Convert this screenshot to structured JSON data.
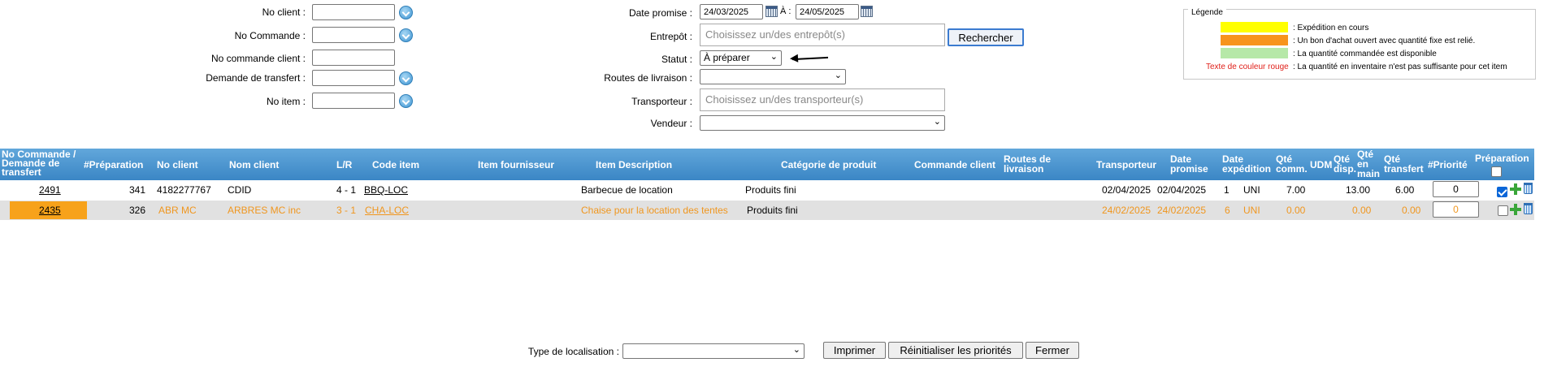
{
  "filters": {
    "no_client_label": "No client :",
    "no_commande_label": "No Commande :",
    "no_commande_client_label": "No commande client :",
    "demande_transfert_label": "Demande de transfert :",
    "no_item_label": "No item :",
    "date_promise_label": "Date promise :",
    "date_from": "24/03/2025",
    "a_label": "À :",
    "date_to": "24/05/2025",
    "entrepot_label": "Entrepôt :",
    "entrepot_placeholder": "Choisissez un/des entrepôt(s)",
    "rechercher_label": "Rechercher",
    "statut_label": "Statut :",
    "statut_value": "À préparer",
    "routes_label": "Routes de livraison :",
    "routes_value": "",
    "transporteur_label": "Transporteur :",
    "transporteur_placeholder": "Choisissez un/des transporteur(s)",
    "vendeur_label": "Vendeur :",
    "vendeur_value": ""
  },
  "legend": {
    "title": "Légende",
    "items": [
      {
        "color": "#ffff00",
        "text": ": Expédition en cours"
      },
      {
        "color": "#f7941d",
        "text": ": Un bon d'achat ouvert avec quantité fixe est relié."
      },
      {
        "color": "#b6e8a8",
        "text": ": La quantité commandée est disponible"
      }
    ],
    "red_label": "Texte de couleur rouge",
    "red_text": ": La quantité en inventaire n'est pas suffisante pour cet item"
  },
  "table": {
    "headers": {
      "no_commande": "No Commande /",
      "demande_de": "Demande de",
      "transfert": "transfert",
      "preparation_no": "#Préparation",
      "no_client": "No client",
      "nom_client": "Nom client",
      "lr": "L/R",
      "code_item": "Code item",
      "item_fournisseur": "Item fournisseur",
      "item_description": "Item Description",
      "categorie": "Catégorie de produit",
      "commande_client": "Commande client",
      "routes_1": "Routes de",
      "routes_2": "livraison",
      "transporteur": "Transporteur",
      "date_promise_1": "Date",
      "date_promise_2": "promise",
      "date_exp_1": "Date",
      "date_exp_2": "expédition",
      "qte_comm_1": "Qté",
      "qte_comm_2": "comm.",
      "udm": "UDM",
      "qte_disp_1": "Qté",
      "qte_disp_2": "disp.",
      "qte_main_1": "Qté",
      "qte_main_2": "en",
      "qte_main_3": "main",
      "qte_transfert_1": "Qté",
      "qte_transfert_2": "transfert",
      "priorite": "#Priorité",
      "preparation": "Préparation"
    },
    "rows": [
      {
        "commande": "2491",
        "preparation": "341",
        "no_client": "4182277767",
        "nom_client": "CDID",
        "lr": "4 - 1",
        "code_item": "BBQ-LOC",
        "item_fournisseur": "",
        "description": "Barbecue de location",
        "categorie": "Produits fini",
        "commande_client": "",
        "routes": "",
        "transporteur": "",
        "date_promise": "02/04/2025",
        "date_expedition": "02/04/2025",
        "qte_comm": "1",
        "udm": "UNI",
        "qte_disp": "7.00",
        "qte_main": "13.00",
        "qte_transfert": "6.00",
        "priorite": "0",
        "checked": true
      },
      {
        "commande": "2435",
        "preparation": "326",
        "no_client": "ABR MC",
        "nom_client": "ARBRES MC inc",
        "lr": "3 - 1",
        "code_item": "CHA-LOC",
        "item_fournisseur": "",
        "description": "Chaise pour la location des tentes",
        "categorie": "Produits fini",
        "commande_client": "",
        "routes": "",
        "transporteur": "",
        "date_promise": "24/02/2025",
        "date_expedition": "24/02/2025",
        "qte_comm": "6",
        "udm": "UNI",
        "qte_disp": "0.00",
        "qte_main": "0.00",
        "qte_transfert": "0.00",
        "priorite": "0",
        "checked": false
      }
    ]
  },
  "footer": {
    "type_localisation_label": "Type de localisation :",
    "type_localisation_value": "",
    "imprimer_label": "Imprimer",
    "reinitialiser_label": "Réinitialiser les priorités",
    "fermer_label": "Fermer"
  },
  "colors": {
    "header_blue": "#3b86c5",
    "orange_highlight": "#f7a21b",
    "orange_text": "#f0961e",
    "row_alt": "#e1e1e1"
  }
}
